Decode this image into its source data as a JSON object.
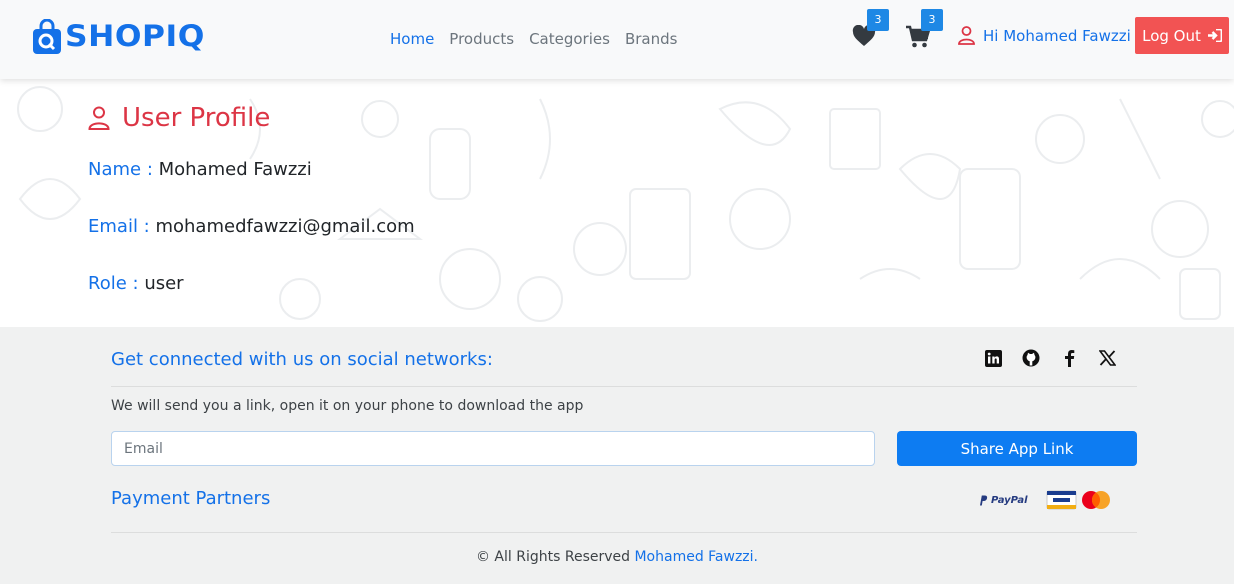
{
  "brand": {
    "name": "SHOPIQ",
    "color": "#1471e8"
  },
  "nav": {
    "links": [
      {
        "label": "Home",
        "active": true
      },
      {
        "label": "Products",
        "active": false
      },
      {
        "label": "Categories",
        "active": false
      },
      {
        "label": "Brands",
        "active": false
      }
    ],
    "wishlist": {
      "icon": "heart-icon",
      "count": "3"
    },
    "cart": {
      "icon": "cart-icon",
      "count": "3"
    },
    "greeting": "Hi Mohamed Fawzzi",
    "logout_label": "Log Out"
  },
  "profile": {
    "title": "User Profile",
    "name_label": "Name :",
    "name_value": "Mohamed Fawzzi",
    "email_label": "Email :",
    "email_value": "mohamedfawzzi@gmail.com",
    "role_label": "Role :",
    "role_value": "user"
  },
  "footer": {
    "social_heading": "Get connected with us on social networks:",
    "social_icons": [
      "linkedin-icon",
      "github-icon",
      "facebook-icon",
      "x-icon"
    ],
    "download_text": "We will send you a link, open it on your phone to download the app",
    "email_placeholder": "Email",
    "share_label": "Share App Link",
    "payment_heading": "Payment Partners",
    "paypal_label": "PayPal",
    "copyright_prefix": "© All Rights Reserved",
    "copyright_name": "Mohamed Fawzzi."
  },
  "colors": {
    "accent": "#1471e8",
    "danger": "#dc3545",
    "logout": "#f25353",
    "badge": "#1e88e5",
    "share": "#0d7cf2"
  }
}
